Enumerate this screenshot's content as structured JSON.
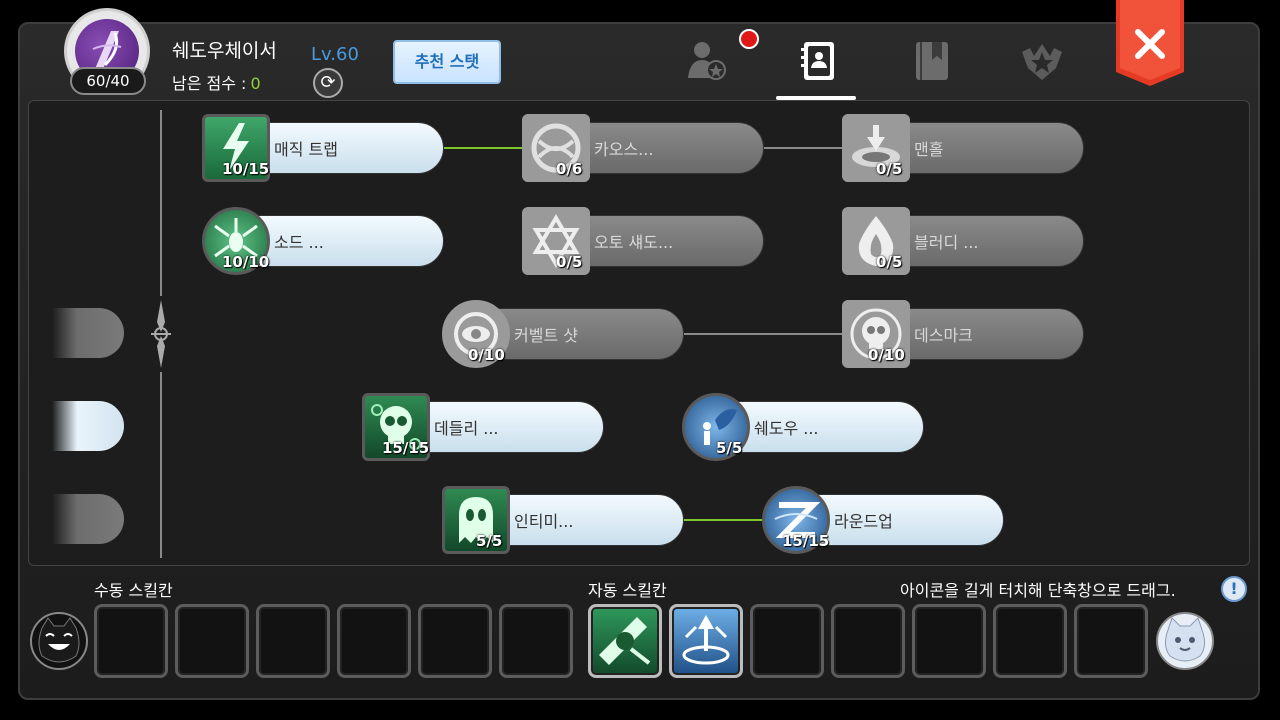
{
  "header": {
    "class_name": "쉐도우체이서",
    "skill_points_badge": "60/40",
    "points_label": "남은 점수 :",
    "points_value": "0",
    "level": "Lv.60",
    "recommend_label": "추천 스탯"
  },
  "tabs": [
    {
      "name": "character-tab",
      "icon": "person-star-icon",
      "active": false,
      "notification": true
    },
    {
      "name": "skill-tree-tab",
      "icon": "contact-book-icon",
      "active": true,
      "notification": false
    },
    {
      "name": "book-tab",
      "icon": "bookmark-book-icon",
      "active": false,
      "notification": false
    },
    {
      "name": "rank-tab",
      "icon": "shield-star-icon",
      "active": false,
      "notification": false
    }
  ],
  "skills": [
    {
      "label": "매직 트랩",
      "level": "10/15",
      "state": "on",
      "icon": "lightning-icon"
    },
    {
      "label": "카오스...",
      "level": "0/6",
      "state": "off",
      "icon": "chaos-swirl-icon"
    },
    {
      "label": "맨홀",
      "level": "0/5",
      "state": "off",
      "icon": "manhole-icon"
    },
    {
      "label": "소드 ...",
      "level": "10/10",
      "state": "on",
      "icon": "sword-spider-icon"
    },
    {
      "label": "오토 섀도...",
      "level": "0/5",
      "state": "off",
      "icon": "hexagram-icon"
    },
    {
      "label": "블러디 ...",
      "level": "0/5",
      "state": "off",
      "icon": "flame-claw-icon"
    },
    {
      "label": "커벨트 샷",
      "level": "0/10",
      "state": "off",
      "icon": "eye-ring-icon"
    },
    {
      "label": "데스마크",
      "level": "0/10",
      "state": "off",
      "icon": "skull-target-icon"
    },
    {
      "label": "데들리 ...",
      "level": "15/15",
      "state": "on",
      "icon": "green-skull-icon"
    },
    {
      "label": "쉐도우 ...",
      "level": "5/5",
      "state": "on",
      "icon": "shadow-figure-icon"
    },
    {
      "label": "인티미...",
      "level": "5/5",
      "state": "on",
      "icon": "ghost-icon"
    },
    {
      "label": "라운드업",
      "level": "15/15",
      "state": "on",
      "icon": "roundup-z-icon"
    }
  ],
  "bottom": {
    "manual_title": "수동 스킬칸",
    "auto_title": "자동 스킬칸",
    "hint": "아이콘을 길게 터치해 단축창으로 드래그."
  },
  "colors": {
    "accent_green": "#7dc62c",
    "level_blue": "#4a9ae0",
    "close_red": "#e53a24"
  }
}
